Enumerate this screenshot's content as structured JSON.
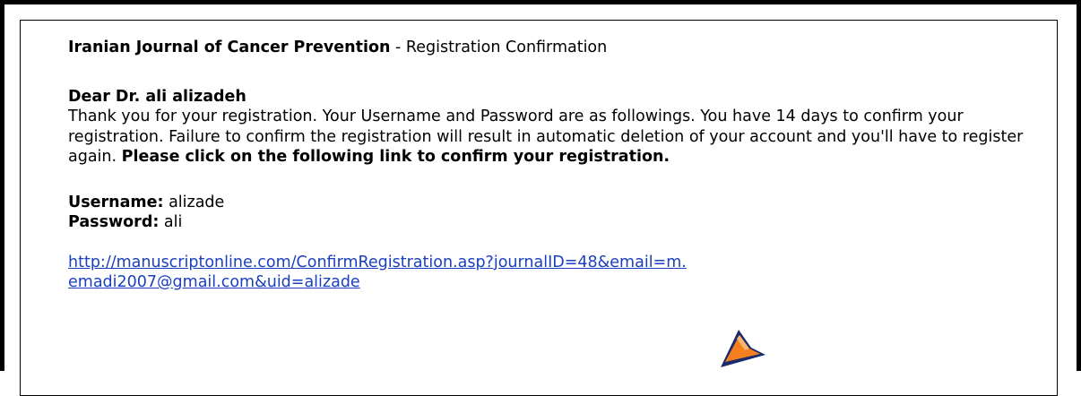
{
  "email": {
    "journal_name": "Iranian Journal of Cancer Prevention",
    "title_separator": " - ",
    "subject": "Registration Confirmation",
    "salutation": "Dear Dr. ali alizadeh",
    "body_text": "Thank you for your registration. Your Username and Password are as followings. You have 14 days to confirm your registration. Failure to confirm the registration will result in automatic deletion of your account and you'll have to register again.",
    "body_emphasis": "Please click on the following link to confirm your registration.",
    "username_label": "Username:",
    "username_value": "alizade",
    "password_label": "Password:",
    "password_value": "ali",
    "link_line1": "http://manuscriptonline.com/ConfirmRegistration.asp?journalID=48&email=m.",
    "link_line2": "emadi2007@gmail.com&uid=alizade"
  },
  "colors": {
    "link": "#1a3fbf",
    "cursor_fill": "#f57f1f",
    "cursor_stroke": "#1a2a6b"
  },
  "icons": {
    "cursor": "pointer-cursor-icon"
  }
}
